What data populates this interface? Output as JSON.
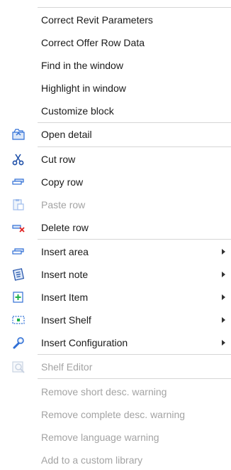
{
  "menu": {
    "items": [
      {
        "label": "Correct Revit Parameters",
        "enabled": true
      },
      {
        "label": "Correct Offer Row Data",
        "enabled": true
      },
      {
        "label": "Find in the window",
        "enabled": true
      },
      {
        "label": "Highlight in window",
        "enabled": true
      },
      {
        "label": "Customize block",
        "enabled": true
      },
      {
        "label": "Open detail",
        "enabled": true,
        "icon": "open-folder-icon"
      },
      {
        "label": "Cut row",
        "enabled": true,
        "icon": "scissors-icon"
      },
      {
        "label": "Copy row",
        "enabled": true,
        "icon": "copy-row-icon"
      },
      {
        "label": "Paste row",
        "enabled": false,
        "icon": "paste-icon"
      },
      {
        "label": "Delete row",
        "enabled": true,
        "icon": "delete-row-icon"
      },
      {
        "label": "Insert area",
        "enabled": true,
        "icon": "insert-area-icon",
        "submenu": true
      },
      {
        "label": "Insert note",
        "enabled": true,
        "icon": "insert-note-icon",
        "submenu": true
      },
      {
        "label": "Insert Item",
        "enabled": true,
        "icon": "insert-item-icon",
        "submenu": true
      },
      {
        "label": "Insert Shelf",
        "enabled": true,
        "icon": "insert-shelf-icon",
        "submenu": true
      },
      {
        "label": "Insert Configuration",
        "enabled": true,
        "icon": "insert-configuration-icon",
        "submenu": true
      },
      {
        "label": "Shelf Editor",
        "enabled": false,
        "icon": "shelf-editor-icon"
      },
      {
        "label": "Remove short desc. warning",
        "enabled": false
      },
      {
        "label": "Remove complete desc. warning",
        "enabled": false
      },
      {
        "label": "Remove language warning",
        "enabled": false
      },
      {
        "label": "Add to a custom library",
        "enabled": false
      }
    ]
  },
  "colors": {
    "text": "#1a1a1a",
    "disabled_text": "#a3a3a3",
    "separator": "#d6d6d6",
    "icon_blue": "#2f6fd6",
    "delete_red": "#e02020",
    "insert_green": "#1fb24a"
  }
}
